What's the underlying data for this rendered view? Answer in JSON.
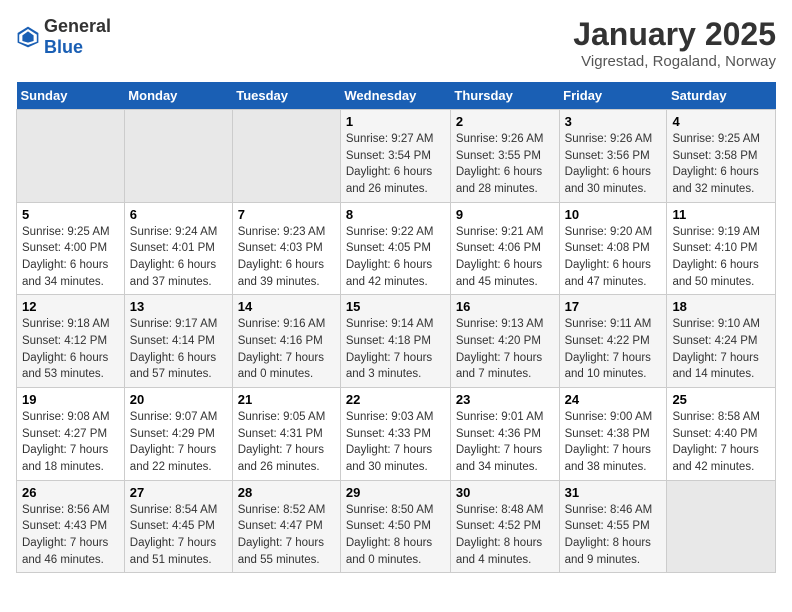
{
  "logo": {
    "general": "General",
    "blue": "Blue"
  },
  "title": "January 2025",
  "subtitle": "Vigrestad, Rogaland, Norway",
  "days_header": [
    "Sunday",
    "Monday",
    "Tuesday",
    "Wednesday",
    "Thursday",
    "Friday",
    "Saturday"
  ],
  "weeks": [
    [
      {
        "num": "",
        "detail": ""
      },
      {
        "num": "",
        "detail": ""
      },
      {
        "num": "",
        "detail": ""
      },
      {
        "num": "1",
        "detail": "Sunrise: 9:27 AM\nSunset: 3:54 PM\nDaylight: 6 hours and 26 minutes."
      },
      {
        "num": "2",
        "detail": "Sunrise: 9:26 AM\nSunset: 3:55 PM\nDaylight: 6 hours and 28 minutes."
      },
      {
        "num": "3",
        "detail": "Sunrise: 9:26 AM\nSunset: 3:56 PM\nDaylight: 6 hours and 30 minutes."
      },
      {
        "num": "4",
        "detail": "Sunrise: 9:25 AM\nSunset: 3:58 PM\nDaylight: 6 hours and 32 minutes."
      }
    ],
    [
      {
        "num": "5",
        "detail": "Sunrise: 9:25 AM\nSunset: 4:00 PM\nDaylight: 6 hours and 34 minutes."
      },
      {
        "num": "6",
        "detail": "Sunrise: 9:24 AM\nSunset: 4:01 PM\nDaylight: 6 hours and 37 minutes."
      },
      {
        "num": "7",
        "detail": "Sunrise: 9:23 AM\nSunset: 4:03 PM\nDaylight: 6 hours and 39 minutes."
      },
      {
        "num": "8",
        "detail": "Sunrise: 9:22 AM\nSunset: 4:05 PM\nDaylight: 6 hours and 42 minutes."
      },
      {
        "num": "9",
        "detail": "Sunrise: 9:21 AM\nSunset: 4:06 PM\nDaylight: 6 hours and 45 minutes."
      },
      {
        "num": "10",
        "detail": "Sunrise: 9:20 AM\nSunset: 4:08 PM\nDaylight: 6 hours and 47 minutes."
      },
      {
        "num": "11",
        "detail": "Sunrise: 9:19 AM\nSunset: 4:10 PM\nDaylight: 6 hours and 50 minutes."
      }
    ],
    [
      {
        "num": "12",
        "detail": "Sunrise: 9:18 AM\nSunset: 4:12 PM\nDaylight: 6 hours and 53 minutes."
      },
      {
        "num": "13",
        "detail": "Sunrise: 9:17 AM\nSunset: 4:14 PM\nDaylight: 6 hours and 57 minutes."
      },
      {
        "num": "14",
        "detail": "Sunrise: 9:16 AM\nSunset: 4:16 PM\nDaylight: 7 hours and 0 minutes."
      },
      {
        "num": "15",
        "detail": "Sunrise: 9:14 AM\nSunset: 4:18 PM\nDaylight: 7 hours and 3 minutes."
      },
      {
        "num": "16",
        "detail": "Sunrise: 9:13 AM\nSunset: 4:20 PM\nDaylight: 7 hours and 7 minutes."
      },
      {
        "num": "17",
        "detail": "Sunrise: 9:11 AM\nSunset: 4:22 PM\nDaylight: 7 hours and 10 minutes."
      },
      {
        "num": "18",
        "detail": "Sunrise: 9:10 AM\nSunset: 4:24 PM\nDaylight: 7 hours and 14 minutes."
      }
    ],
    [
      {
        "num": "19",
        "detail": "Sunrise: 9:08 AM\nSunset: 4:27 PM\nDaylight: 7 hours and 18 minutes."
      },
      {
        "num": "20",
        "detail": "Sunrise: 9:07 AM\nSunset: 4:29 PM\nDaylight: 7 hours and 22 minutes."
      },
      {
        "num": "21",
        "detail": "Sunrise: 9:05 AM\nSunset: 4:31 PM\nDaylight: 7 hours and 26 minutes."
      },
      {
        "num": "22",
        "detail": "Sunrise: 9:03 AM\nSunset: 4:33 PM\nDaylight: 7 hours and 30 minutes."
      },
      {
        "num": "23",
        "detail": "Sunrise: 9:01 AM\nSunset: 4:36 PM\nDaylight: 7 hours and 34 minutes."
      },
      {
        "num": "24",
        "detail": "Sunrise: 9:00 AM\nSunset: 4:38 PM\nDaylight: 7 hours and 38 minutes."
      },
      {
        "num": "25",
        "detail": "Sunrise: 8:58 AM\nSunset: 4:40 PM\nDaylight: 7 hours and 42 minutes."
      }
    ],
    [
      {
        "num": "26",
        "detail": "Sunrise: 8:56 AM\nSunset: 4:43 PM\nDaylight: 7 hours and 46 minutes."
      },
      {
        "num": "27",
        "detail": "Sunrise: 8:54 AM\nSunset: 4:45 PM\nDaylight: 7 hours and 51 minutes."
      },
      {
        "num": "28",
        "detail": "Sunrise: 8:52 AM\nSunset: 4:47 PM\nDaylight: 7 hours and 55 minutes."
      },
      {
        "num": "29",
        "detail": "Sunrise: 8:50 AM\nSunset: 4:50 PM\nDaylight: 8 hours and 0 minutes."
      },
      {
        "num": "30",
        "detail": "Sunrise: 8:48 AM\nSunset: 4:52 PM\nDaylight: 8 hours and 4 minutes."
      },
      {
        "num": "31",
        "detail": "Sunrise: 8:46 AM\nSunset: 4:55 PM\nDaylight: 8 hours and 9 minutes."
      },
      {
        "num": "",
        "detail": ""
      }
    ]
  ]
}
